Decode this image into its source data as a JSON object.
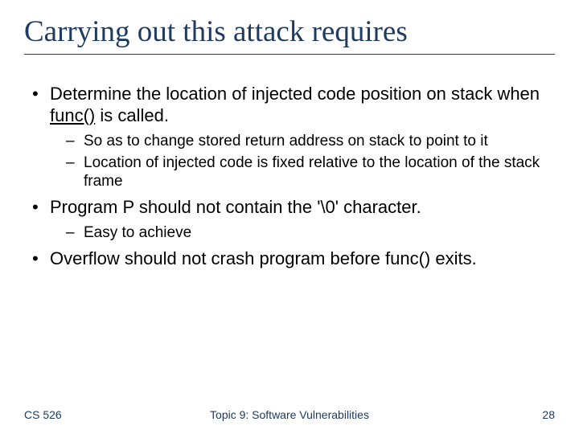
{
  "title": "Carrying out this attack requires",
  "bullets": [
    {
      "text_parts": [
        "Determine the location of injected code position on stack when ",
        "func()",
        " is called."
      ],
      "underline_idx": 1,
      "subs": [
        "So as to change stored return address on stack to point to it",
        "Location of injected code is fixed relative to the location of the stack frame"
      ]
    },
    {
      "text_parts": [
        "Program P should not contain the '\\0'  character."
      ],
      "underline_idx": -1,
      "subs": [
        "Easy to achieve"
      ]
    },
    {
      "text_parts": [
        "Overflow should not crash program before  func() exits."
      ],
      "underline_idx": -1,
      "subs": []
    }
  ],
  "footer": {
    "left": "CS 526",
    "center": "Topic 9: Software Vulnerabilities",
    "right": "28"
  }
}
